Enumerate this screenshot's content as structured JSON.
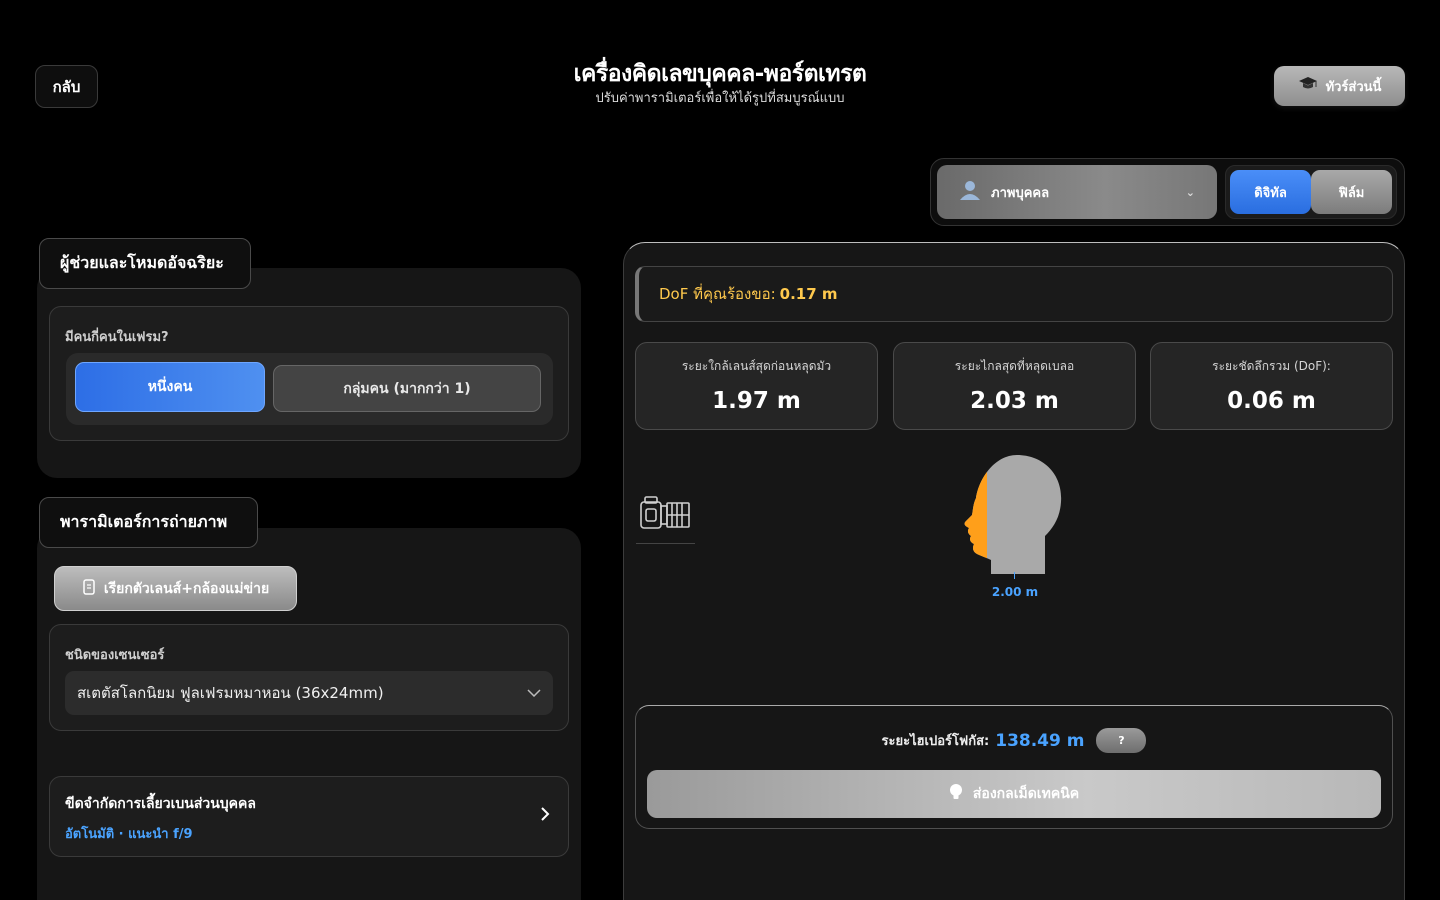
{
  "header": {
    "back_label": "กลับ",
    "title": "เครื่องคิดเลขบุคคล-พอร์ตเทรต",
    "subtitle": "ปรับค่าพารามิเตอร์เพื่อให้ได้รูปที่สมบูรณ์แบบ",
    "tour_label": "ทัวร์ส่วนนี้",
    "tour_icon": "graduation-cap-icon"
  },
  "mode": {
    "subject_select": "ภาพบุคคล",
    "subject_icon": "person-icon",
    "digital_label": "ดิจิทัล",
    "film_label": "ฟิล์ม",
    "selected": "ดิจิทัล"
  },
  "assistant": {
    "section_title": "ผู้ช่วยและโหมดอัจฉริยะ",
    "people_question": "มีคนกี่คนในเฟรม?",
    "single_label": "หนึ่งคน",
    "group_label": "กลุ่มคน (มากกว่า 1)",
    "selected": "หนึ่งคน"
  },
  "params": {
    "section_title": "พารามิเตอร์การถ่ายภาพ",
    "lens_button_label": "เรียกตัวเลนส์+กล้องแม่ข่าย",
    "lens_button_icon": "document-icon",
    "sensor_label": "ชนิดของเซนเซอร์",
    "sensor_value": "สเตตัสโลกนิยม ฟูลเฟรมหมาหอน (36x24mm)",
    "aperture_title": "ขีดจำกัดการเลี้ยวเบนส่วนบุคคล",
    "aperture_sub": "อัตโนมัติ · แนะนำ f/9"
  },
  "results": {
    "dof_required_label": "DoF ที่คุณร้องขอ:",
    "dof_required_value": "0.17 m",
    "stats": [
      {
        "label": "ระยะใกล้เลนส์สุดก่อนหลุดมัว",
        "value": "1.97 m"
      },
      {
        "label": "ระยะไกลสุดที่หลุดเบลอ",
        "value": "2.03 m"
      },
      {
        "label": "ระยะชัดลึกรวม (DoF):",
        "value": "0.06 m"
      }
    ],
    "subject_distance": "2.00 m",
    "in_focus_fraction": 0.15,
    "hyperfocal_label": "ระยะไฮเปอร์โฟกัส:",
    "hyperfocal_value": "138.49 m",
    "help_label": "?",
    "tip_label": "ส่องกลเม็ดเทคนิค",
    "tip_icon": "lightbulb-icon"
  },
  "colors": {
    "accent_blue": "#4aa3ff",
    "focus_orange": "#ff9f1a",
    "dof_yellow": "#ffc94d"
  }
}
